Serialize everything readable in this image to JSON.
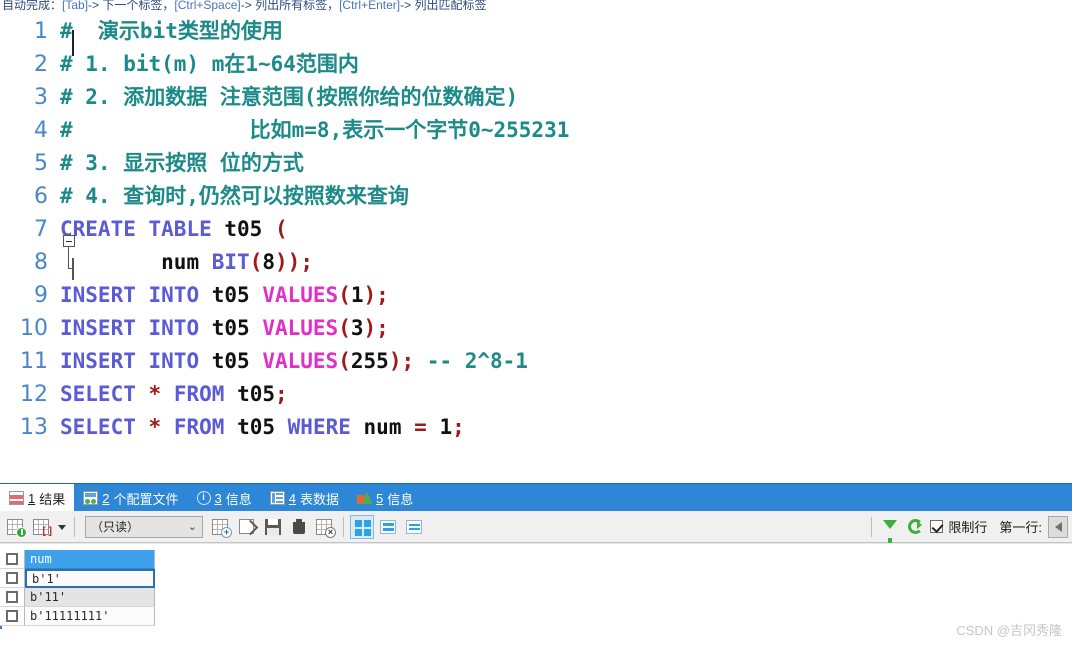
{
  "hint": {
    "prefix": "自动完成：",
    "seg1_key": "[Tab]",
    "seg1_text": "-> 下一个标签，",
    "seg2_key": "[Ctrl+Space]",
    "seg2_text": "-> 列出所有标签，",
    "seg3_key": "[Ctrl+Enter]",
    "seg3_text": "-> 列出匹配标签"
  },
  "editor": {
    "lines": [
      {
        "no": "1",
        "text": "#  演示bit类型的使用"
      },
      {
        "no": "2",
        "text": "# 1. bit(m) m在1~64范围内"
      },
      {
        "no": "3",
        "text": "# 2. 添加数据 注意范围(按照你给的位数确定)"
      },
      {
        "no": "4",
        "text": "#              比如m=8,表示一个字节0~255231"
      },
      {
        "no": "5",
        "text": "# 3. 显示按照 位的方式"
      },
      {
        "no": "6",
        "text": "# 4. 查询时,仍然可以按照数来查询"
      },
      {
        "no": "7",
        "text": "CREATE TABLE t05 ("
      },
      {
        "no": "8",
        "text": "        num BIT(8));"
      },
      {
        "no": "9",
        "text": "INSERT INTO t05 VALUES(1);"
      },
      {
        "no": "10",
        "text": "INSERT INTO t05 VALUES(3);"
      },
      {
        "no": "11",
        "text": "INSERT INTO t05 VALUES(255); -- 2^8-1"
      },
      {
        "no": "12",
        "text": "SELECT * FROM t05;"
      },
      {
        "no": "13",
        "text": "SELECT * FROM t05 WHERE num = 1;"
      }
    ],
    "colors": {
      "comment": "#1d8a8a",
      "keyword": "#5b5bd6",
      "keyword_values": "#e030c8",
      "identifier": "#111111",
      "punctuation": "#a01818",
      "line_number": "#4a86c8"
    }
  },
  "tabs": [
    {
      "num": "1",
      "label": "结果",
      "icon": "result-grid-icon",
      "active": true
    },
    {
      "num": "2",
      "label": "个配置文件",
      "icon": "profile-icon",
      "active": false
    },
    {
      "num": "3",
      "label": "信息",
      "icon": "info-circle-icon",
      "active": false
    },
    {
      "num": "4",
      "label": "表数据",
      "icon": "table-data-icon",
      "active": false
    },
    {
      "num": "5",
      "label": "信息",
      "icon": "chart-icon",
      "active": false
    }
  ],
  "toolbar": {
    "mode_value": "（只读）",
    "chevron": "⌄",
    "limit_rows_label": "限制行",
    "first_row_label": "第一行:",
    "buttons": [
      {
        "name": "apply-changes-button",
        "title": "应用"
      },
      {
        "name": "grid-options-button",
        "title": "网格选项"
      },
      {
        "name": "insert-record-button",
        "title": "插入记录"
      },
      {
        "name": "export-record-button",
        "title": "导出"
      },
      {
        "name": "save-record-button",
        "title": "保存"
      },
      {
        "name": "delete-record-button",
        "title": "删除"
      },
      {
        "name": "cancel-edit-button",
        "title": "取消编辑"
      },
      {
        "name": "grid-view-button",
        "title": "网格视图"
      },
      {
        "name": "form-view-button",
        "title": "表单视图"
      },
      {
        "name": "text-view-button",
        "title": "文本视图"
      },
      {
        "name": "filter-button",
        "title": "筛选"
      },
      {
        "name": "refresh-button",
        "title": "刷新"
      }
    ]
  },
  "results": {
    "columns": [
      "num"
    ],
    "rows": [
      {
        "cells": [
          "b'1'"
        ],
        "selected": true
      },
      {
        "cells": [
          "b'11'"
        ],
        "selected": false
      },
      {
        "cells": [
          "b'11111111'"
        ],
        "selected": false
      }
    ]
  },
  "watermark": "CSDN @吉冈秀隆"
}
